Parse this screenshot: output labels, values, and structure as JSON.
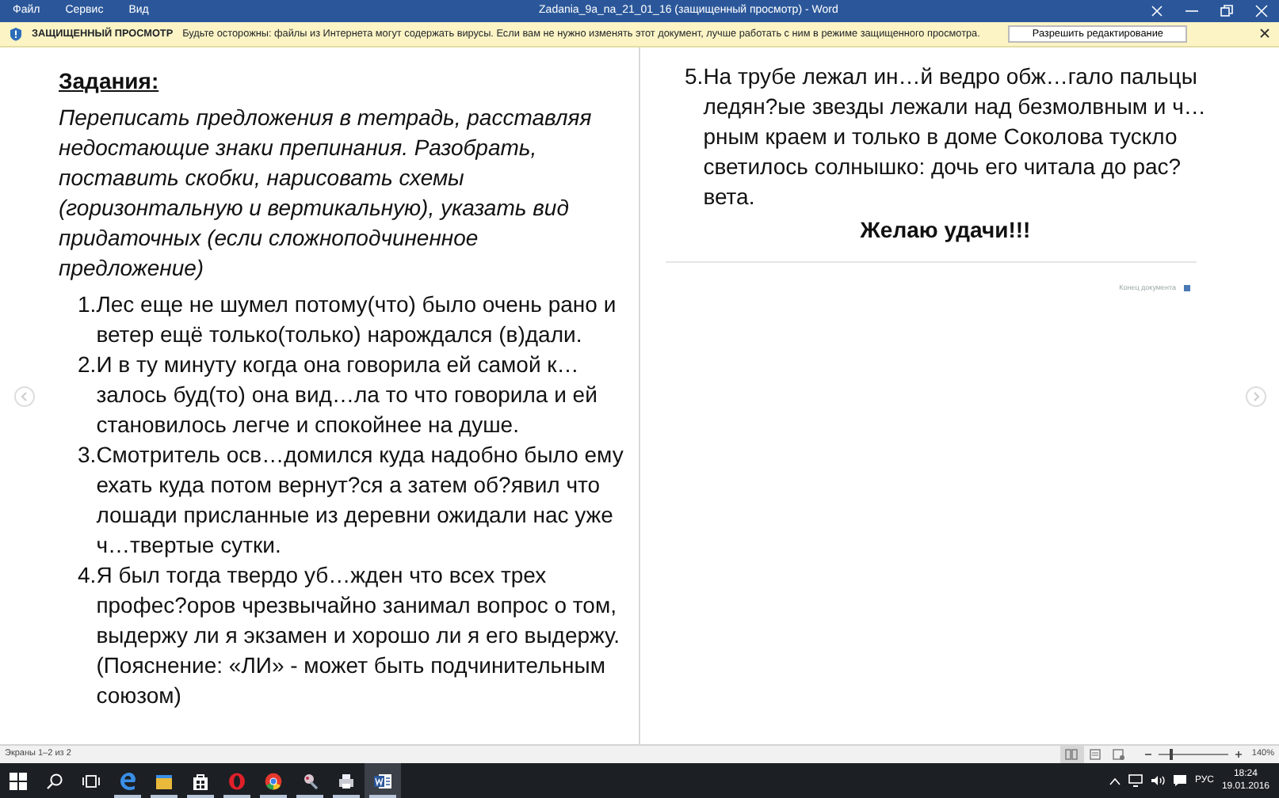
{
  "title_bar": {
    "menu": [
      "Файл",
      "Сервис",
      "Вид"
    ],
    "title": "Zadania_9a_na_21_01_16 (защищенный просмотр) - Word"
  },
  "protected_view": {
    "label": "ЗАЩИЩЕННЫЙ ПРОСМОТР",
    "message": "Будьте осторожны: файлы из Интернета могут содержать вирусы. Если вам не нужно изменять этот документ, лучше работать с ним в режиме защищенного просмотра.",
    "button": "Разрешить редактирование"
  },
  "left_page": {
    "heading": "Задания:",
    "instructions": "Переписать предложения в тетрадь, расставляя недостающие знаки препинания.  Разобрать, поставить скобки, нарисовать схемы (горизонтальную и вертикальную), указать вид придаточных (если сложноподчиненное предложение)",
    "tasks": [
      {
        "number": "1.",
        "text": "Лес еще не шумел потому(что) было очень рано и ветер ещё только(только) нарождался (в)дали."
      },
      {
        "number": "2.",
        "text": "И в ту минуту когда она говорила ей самой к…залось буд(то) она вид…ла то что говорила и ей становилось легче и спокойнее на душе."
      },
      {
        "number": "3.",
        "text": "Смотритель осв…домился куда надобно было ему ехать куда потом вернут?ся а затем об?явил что лошади присланные из деревни ожидали нас уже ч…твертые сутки."
      },
      {
        "number": "4.",
        "text": "Я был тогда твердо уб…жден что всех трех профес?оров чрезвычайно занимал вопрос о том, выдержу ли я экзамен и хорошо ли я его выдержу. (Пояснение: «ЛИ» - может быть подчинительным союзом)"
      }
    ]
  },
  "right_page": {
    "tasks": [
      {
        "number": "5.",
        "text": "На трубе лежал ин…й ведро обж…гало пальцы ледян?ые звезды лежали над безмолвным и ч…рным краем и только в доме Соколова тускло светилось солнышко: дочь его читала до рас?вета."
      }
    ],
    "closing": "Желаю удачи!!!",
    "end_mark": "Конец документа"
  },
  "status_bar": {
    "page_info": "Экраны 1–2 из 2",
    "views": [
      {
        "kind": "read",
        "selected": true
      },
      {
        "kind": "print",
        "selected": false
      },
      {
        "kind": "web",
        "selected": false
      }
    ],
    "zoom": {
      "level": 0.15
    },
    "zoom_text": "140%"
  },
  "taskbar": {
    "apps": [
      {
        "kind": "edge",
        "selected": false
      },
      {
        "kind": "explorer",
        "selected": false
      },
      {
        "kind": "store",
        "selected": false
      },
      {
        "kind": "opera",
        "selected": false
      },
      {
        "kind": "chrome",
        "selected": false
      },
      {
        "kind": "tool",
        "selected": false
      },
      {
        "kind": "printer",
        "selected": false
      },
      {
        "kind": "word",
        "selected": true
      }
    ],
    "language": "РУС",
    "time": "18:24",
    "date": "19.01.2016"
  }
}
